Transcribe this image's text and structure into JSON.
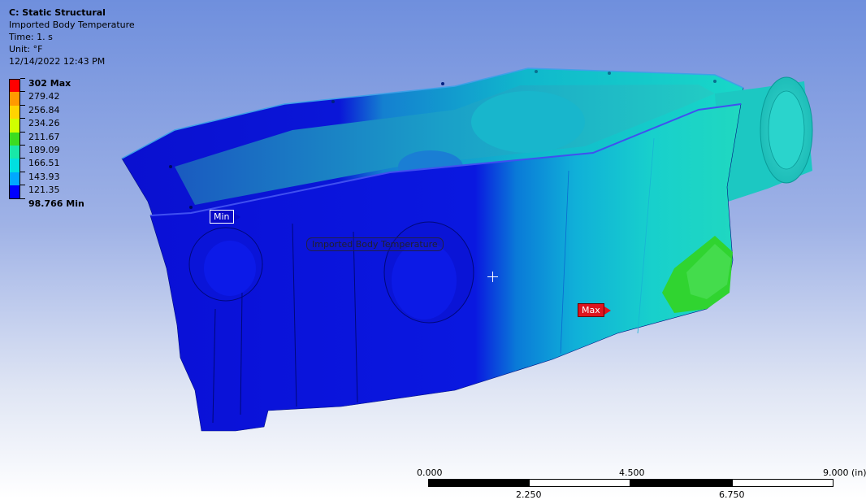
{
  "info": {
    "title": "C: Static Structural",
    "result_name": "Imported Body Temperature",
    "time": "Time: 1. s",
    "unit": "Unit: °F",
    "timestamp": "12/14/2022 12:43 PM"
  },
  "legend": [
    {
      "label": "302 Max",
      "color": "#ff0000",
      "bold": true
    },
    {
      "label": "279.42",
      "color": "#ff9a00",
      "bold": false
    },
    {
      "label": "256.84",
      "color": "#ffd400",
      "bold": false
    },
    {
      "label": "234.26",
      "color": "#d0ff00",
      "bold": false
    },
    {
      "label": "211.67",
      "color": "#3cdc20",
      "bold": false
    },
    {
      "label": "189.09",
      "color": "#18e8a8",
      "bold": false
    },
    {
      "label": "166.51",
      "color": "#00e0e0",
      "bold": false
    },
    {
      "label": "143.93",
      "color": "#00a8ff",
      "bold": false
    },
    {
      "label": "121.35",
      "color": "#0000ff",
      "bold": false
    },
    {
      "label": "98.766 Min",
      "color": null,
      "bold": true
    }
  ],
  "probes": {
    "min_label": "Min",
    "max_label": "Max",
    "result_tag": "Imported Body Temperature"
  },
  "scale_bar": {
    "top_labels": [
      "0.000",
      "4.500",
      "9.000 (in)"
    ],
    "bottom_labels": [
      "2.250",
      "6.750"
    ]
  },
  "colors": {
    "background_top": "#6f8fdd",
    "background_bottom": "#ffffff",
    "model_cold": "#0a0ad8",
    "model_mid": "#00d8d8",
    "model_hot": "#30d820"
  }
}
